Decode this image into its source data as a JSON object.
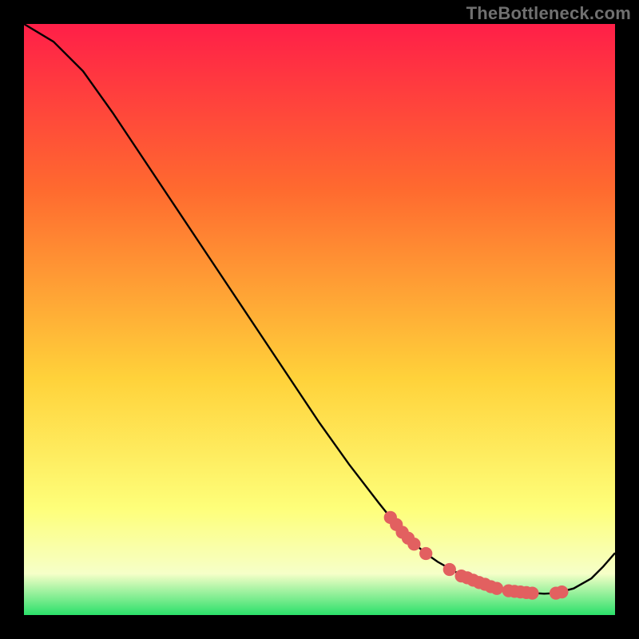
{
  "watermark": "TheBottleneck.com",
  "chart_data": {
    "type": "line",
    "title": "",
    "xlabel": "",
    "ylabel": "",
    "xlim": [
      0,
      100
    ],
    "ylim": [
      0,
      100
    ],
    "grid": false,
    "series": [
      {
        "name": "curve",
        "x": [
          0,
          5,
          10,
          15,
          20,
          25,
          30,
          35,
          40,
          45,
          50,
          55,
          60,
          62,
          65,
          68,
          70,
          73,
          75,
          78,
          80,
          82,
          85,
          88,
          90,
          93,
          96,
          98,
          100
        ],
        "y": [
          100,
          97,
          92,
          85,
          77.5,
          70,
          62.5,
          55,
          47.5,
          40,
          32.5,
          25.5,
          19,
          16.5,
          13,
          10.4,
          9,
          7.3,
          6.3,
          5.2,
          4.5,
          4.1,
          3.8,
          3.6,
          3.7,
          4.5,
          6.2,
          8.2,
          10.5
        ]
      }
    ],
    "highlight_points": {
      "name": "markers",
      "x": [
        62,
        63,
        64,
        65,
        66,
        68,
        72,
        74,
        75,
        76,
        77,
        78,
        79,
        80,
        82,
        83,
        84,
        85,
        86,
        90,
        91
      ],
      "y": [
        16.5,
        15.3,
        14,
        13,
        12,
        10.4,
        7.7,
        6.6,
        6.3,
        5.9,
        5.5,
        5.2,
        4.8,
        4.5,
        4.1,
        4.0,
        3.9,
        3.8,
        3.7,
        3.7,
        3.9
      ]
    }
  },
  "colors": {
    "grad_stops": [
      "#ff1f48",
      "#ff6a2f",
      "#ffd23a",
      "#feff7a",
      "#f6ffc8",
      "#2be06a"
    ],
    "curve": "#000000",
    "dot": "#e26060",
    "watermark": "#707070"
  }
}
